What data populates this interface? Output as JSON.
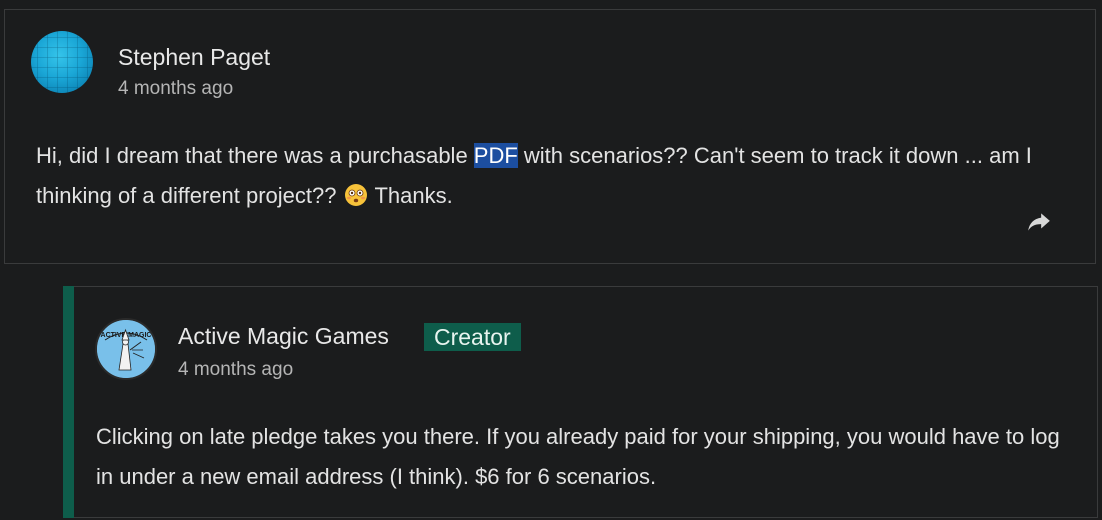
{
  "comment": {
    "author": "Stephen Paget",
    "time": "4 months ago",
    "text_before": "Hi, did I dream that there was a purchasable ",
    "highlight": "PDF",
    "text_after": " with scenarios?? Can't seem to track it down ... am I thinking of a different project??",
    "emoji": "flushed-face",
    "text_end": "Thanks.",
    "share_icon": "share-arrow-icon"
  },
  "reply": {
    "author": "Active Magic Games",
    "badge": "Creator",
    "avatar_text": "ACTIVE MAGIC",
    "time": "4 months ago",
    "text": "Clicking on late pledge takes you there. If you already paid for your shipping, you would have to log in under a new email address (I think). $6 for 6 scenarios.",
    "accent_color": "#0e5d4b"
  },
  "colors": {
    "background": "#1b1c1d",
    "border": "#3a3b3c",
    "highlight": "#1c4ea0"
  }
}
